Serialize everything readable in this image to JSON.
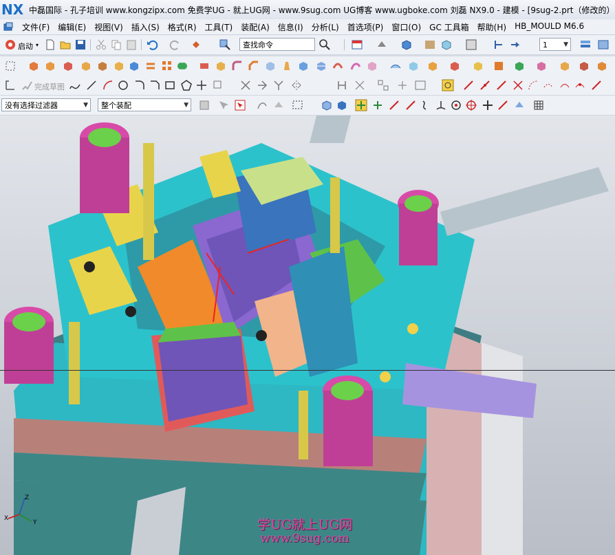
{
  "title": {
    "logo": "NX",
    "text": "中磊国际 - 孔子培训 www.kongzipx.com 免费学UG - 就上UG网 - www.9sug.com  UG博客 www.ugboke.com 刘磊  NX9.0 - 建模 - [9sug-2.prt（修改的）"
  },
  "menu": [
    "文件(F)",
    "编辑(E)",
    "视图(V)",
    "插入(S)",
    "格式(R)",
    "工具(T)",
    "装配(A)",
    "信息(I)",
    "分析(L)",
    "首选项(P)",
    "窗口(O)",
    "GC 工具箱",
    "帮助(H)",
    "HB_MOULD M6.6"
  ],
  "toolbar1": {
    "start_label": "启动",
    "search_placeholder": "查找命令",
    "layer_value": "1"
  },
  "toolbar3": {
    "finish_sketch_label": "完成草图"
  },
  "toolbar4": {
    "selection_filter": "没有选择过滤器",
    "assembly_scope": "整个装配"
  },
  "viewport": {
    "watermark_line1": "学UG就上UG网",
    "watermark_line2": "www.9sug.com",
    "axis_labels": [
      "X",
      "Y",
      "Z"
    ]
  },
  "colors": {
    "accent": "#1d6ec6",
    "watermark": "#d94aa5"
  }
}
